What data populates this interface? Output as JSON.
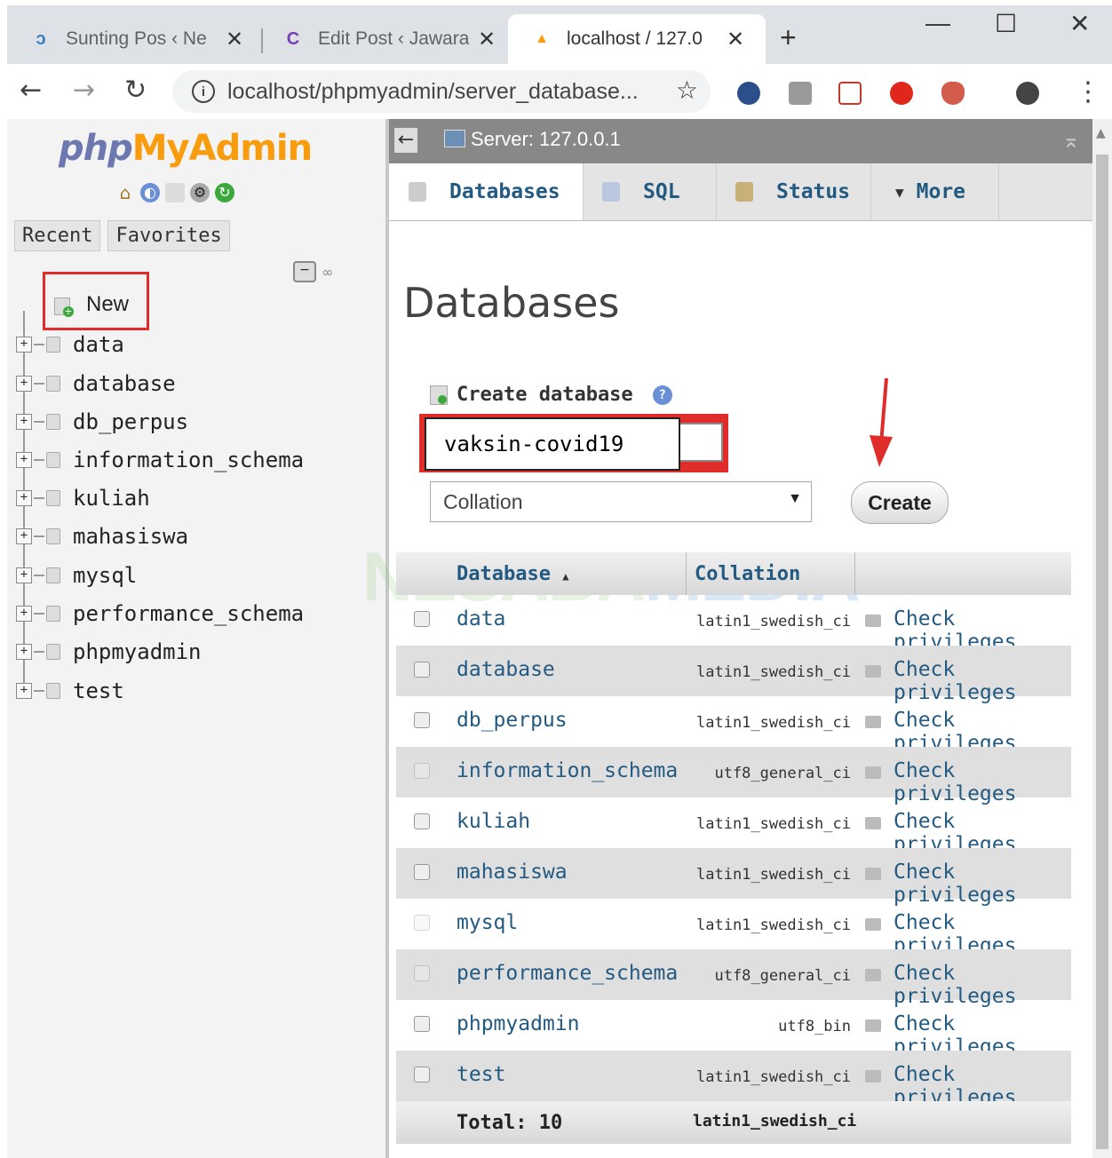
{
  "browser": {
    "tabs": [
      {
        "title": "Sunting Pos ‹ Ne",
        "close": "✕"
      },
      {
        "title": "Edit Post ‹ Jawara",
        "close": "✕"
      },
      {
        "title": "localhost / 127.0",
        "close": "✕"
      }
    ],
    "new_tab": "+",
    "url": "localhost/phpmyadmin/server_database...",
    "window_controls": {
      "minimize": "—",
      "maximize": "☐",
      "close": "✕"
    }
  },
  "nav": {
    "logo_php": "php",
    "logo_myadmin": "MyAdmin",
    "tabs": [
      "Recent",
      "Favorites"
    ],
    "new_label": "New",
    "databases": [
      "data",
      "database",
      "db_perpus",
      "information_schema",
      "kuliah",
      "mahasiswa",
      "mysql",
      "performance_schema",
      "phpmyadmin",
      "test"
    ]
  },
  "main": {
    "server": "Server: 127.0.0.1",
    "menu": [
      "Databases",
      "SQL",
      "Status",
      "More"
    ],
    "title": "Databases",
    "create_label": "Create database",
    "db_name_value": "vaksin-covid19",
    "collation_label": "Collation",
    "create_button": "Create",
    "watermark": {
      "a": "NESABA",
      "b": "MEDIA"
    },
    "table": {
      "headers": [
        "Database",
        "Collation"
      ],
      "rows": [
        {
          "name": "data",
          "collation": "latin1_swedish_ci",
          "action": "Check privileges"
        },
        {
          "name": "database",
          "collation": "latin1_swedish_ci",
          "action": "Check privileges"
        },
        {
          "name": "db_perpus",
          "collation": "latin1_swedish_ci",
          "action": "Check privileges"
        },
        {
          "name": "information_schema",
          "collation": "utf8_general_ci",
          "action": "Check privileges"
        },
        {
          "name": "kuliah",
          "collation": "latin1_swedish_ci",
          "action": "Check privileges"
        },
        {
          "name": "mahasiswa",
          "collation": "latin1_swedish_ci",
          "action": "Check privileges"
        },
        {
          "name": "mysql",
          "collation": "latin1_swedish_ci",
          "action": "Check privileges"
        },
        {
          "name": "performance_schema",
          "collation": "utf8_general_ci",
          "action": "Check privileges"
        },
        {
          "name": "phpmyadmin",
          "collation": "utf8_bin",
          "action": "Check privileges"
        },
        {
          "name": "test",
          "collation": "latin1_swedish_ci",
          "action": "Check privileges"
        }
      ],
      "total_label": "Total: 10",
      "total_collation": "latin1_swedish_ci"
    }
  }
}
